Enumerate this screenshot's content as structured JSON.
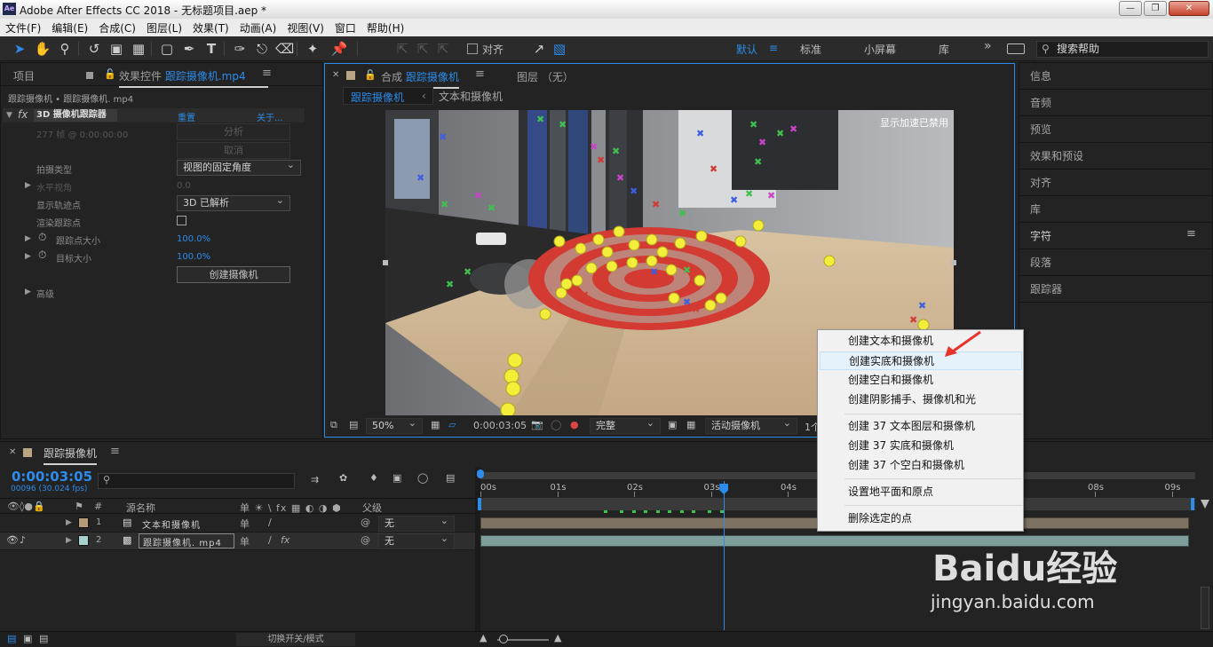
{
  "titlebar": {
    "title": "Adobe After Effects CC 2018 - 无标题项目.aep *",
    "logo": "Ae"
  },
  "menu": [
    "文件(F)",
    "编辑(E)",
    "合成(C)",
    "图层(L)",
    "效果(T)",
    "动画(A)",
    "视图(V)",
    "窗口",
    "帮助(H)"
  ],
  "toolbar": {
    "snap_label": "对齐",
    "workspaces": [
      "默认",
      "标准",
      "小屏幕",
      "库"
    ],
    "active_workspace": "默认",
    "more": "»",
    "search_placeholder": "搜索帮助"
  },
  "left_panel": {
    "tab_project": "项目",
    "tab_effects_prefix": "效果控件",
    "tab_effects_target": "跟踪摄像机.mp4",
    "breadcrumb": "跟踪摄像机 • 跟踪摄像机. mp4",
    "effect_name": "3D 摄像机跟踪器",
    "reset": "重置",
    "about": "关于...",
    "frames_info": "277 帧 @ 0:00:00:00",
    "analyze_button": "分析",
    "cancel_button": "取消",
    "shot_type_label": "拍摄类型",
    "shot_type_value": "视图的固定角度",
    "hfov_label": "水平视角",
    "hfov_value": "0.0",
    "show_track_label": "显示轨迹点",
    "show_track_value": "3D 已解析",
    "render_track_label": "渲染跟踪点",
    "track_size_label": "跟踪点大小",
    "track_size_value": "100.0%",
    "target_size_label": "目标大小",
    "target_size_value": "100.0%",
    "create_camera_button": "创建摄像机",
    "advanced_label": "高级"
  },
  "viewer": {
    "tab_prefix": "合成",
    "tab_comp": "跟踪摄像机",
    "layer_tab": "图层 （无）",
    "nav_active": "跟踪摄像机",
    "nav_next": "文本和摄像机",
    "accel_notice": "显示加速已禁用",
    "zoom": "50%",
    "timecode": "0:00:03:05",
    "resolution": "完整",
    "camera": "活动摄像机",
    "views": "1个"
  },
  "context_menu": {
    "items": [
      "创建文本和摄像机",
      "创建实底和摄像机",
      "创建空白和摄像机",
      "创建阴影捕手、摄像机和光",
      "创建 37 文本图层和摄像机",
      "创建 37 实底和摄像机",
      "创建 37 个空白和摄像机",
      "设置地平面和原点",
      "删除选定的点"
    ],
    "hovered_index": 1
  },
  "right_panel": {
    "items": [
      "信息",
      "音频",
      "预览",
      "效果和预设",
      "对齐",
      "库",
      "字符",
      "段落",
      "跟踪器"
    ]
  },
  "timeline": {
    "tab": "跟踪摄像机",
    "timecode": "0:00:03:05",
    "frame_info": "00096 (30.024 fps)",
    "search_placeholder": "",
    "col_hash": "#",
    "col_source": "源名称",
    "col_parent": "父级",
    "switches": "单 ☀ \\ fx ▦ ◐ ◑ ⬢",
    "layers": [
      {
        "num": "1",
        "name": "文本和摄像机",
        "parent": "无",
        "color": "#b59a76"
      },
      {
        "num": "2",
        "name": "跟踪摄像机. mp4",
        "parent": "无",
        "color": "#a7d1cd"
      }
    ],
    "ruler": [
      "00s",
      "01s",
      "02s",
      "03s",
      "04s",
      "08s",
      "09s"
    ],
    "current_time_sec": 3.17,
    "toggle_label": "切换开关/模式"
  },
  "watermark": {
    "brand": "Baidu经验",
    "url": "jingyan.baidu.com"
  },
  "colors": {
    "accent": "#2d8ceb",
    "panel": "#232323",
    "target_red": "#d23a32",
    "track_yellow": "#f2ee3a"
  }
}
